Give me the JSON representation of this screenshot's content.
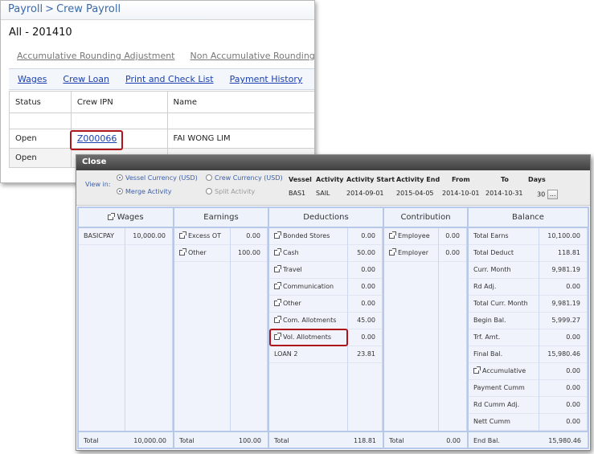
{
  "crew_payroll": {
    "breadcrumb": [
      "Payroll",
      "Crew Payroll"
    ],
    "breadcrumb_separator": ">",
    "title": "All - 201410",
    "adjustment_links": [
      "Accumulative Rounding Adjustment",
      "Non Accumulative Rounding Ad"
    ],
    "tabs": [
      "Wages",
      "Crew Loan",
      "Print and Check List",
      "Payment History"
    ],
    "columns": [
      "Status",
      "Crew IPN",
      "Name"
    ],
    "rows": [
      {
        "status": "Open",
        "ipn": "Z000066",
        "name": "FAI WONG LIM"
      },
      {
        "status": "Open",
        "ipn": "",
        "name": ""
      }
    ]
  },
  "dialog": {
    "close_label": "Close",
    "view_in_label": "View in:",
    "currency_options": {
      "vessel": "Vessel Currency (USD)",
      "crew": "Crew Currency (USD)",
      "selected": "vessel"
    },
    "activity_options": {
      "merge": "Merge Activity",
      "split": "Split Activity",
      "selected": "merge"
    },
    "info_headers": [
      "Vessel",
      "Activity",
      "Activity Start",
      "Activity End",
      "From",
      "To",
      "Days"
    ],
    "info_values": [
      "BAS1",
      "SAIL",
      "2014-09-01",
      "2015-04-05",
      "2014-10-01",
      "2014-10-31",
      "30"
    ],
    "more_button": "...",
    "wages": {
      "header": "Wages",
      "items": [
        {
          "label": "BASICPAY",
          "amount": "10,000.00"
        }
      ],
      "total_label": "Total",
      "total": "10,000.00"
    },
    "earnings": {
      "header": "Earnings",
      "items": [
        {
          "label": "Excess OT",
          "amount": "0.00"
        },
        {
          "label": "Other",
          "amount": "100.00"
        }
      ],
      "total_label": "Total",
      "total": "100.00"
    },
    "deductions": {
      "header": "Deductions",
      "items": [
        {
          "label": "Bonded Stores",
          "amount": "0.00"
        },
        {
          "label": "Cash",
          "amount": "50.00"
        },
        {
          "label": "Travel",
          "amount": "0.00"
        },
        {
          "label": "Communication",
          "amount": "0.00"
        },
        {
          "label": "Other",
          "amount": "0.00"
        },
        {
          "label": "Com. Allotments",
          "amount": "45.00"
        },
        {
          "label": "Vol. Allotments",
          "amount": "0.00"
        },
        {
          "label": "LOAN 2",
          "amount": "23.81"
        }
      ],
      "total_label": "Total",
      "total": "118.81"
    },
    "contribution": {
      "header": "Contribution",
      "items": [
        {
          "label": "Employee",
          "amount": "0.00"
        },
        {
          "label": "Employer",
          "amount": "0.00"
        }
      ],
      "total_label": "Total",
      "total": "0.00"
    },
    "balance": {
      "header": "Balance",
      "items": [
        {
          "label": "Total Earns",
          "amount": "10,100.00"
        },
        {
          "label": "Total Deduct",
          "amount": "118.81"
        },
        {
          "label": "Curr. Month",
          "amount": "9,981.19"
        },
        {
          "label": "Rd Adj.",
          "amount": "0.00"
        },
        {
          "label": "Total Curr. Month",
          "amount": "9,981.19"
        },
        {
          "label": "Begin Bal.",
          "amount": "5,999.27"
        },
        {
          "label": "Trf. Amt.",
          "amount": "0.00"
        },
        {
          "label": "Final Bal.",
          "amount": "15,980.46"
        },
        {
          "label": "Accumulative",
          "amount": "0.00"
        },
        {
          "label": "Payment Cumm",
          "amount": "0.00"
        },
        {
          "label": "Rd Cumm Adj.",
          "amount": "0.00"
        },
        {
          "label": "Nett Cumm",
          "amount": "0.00"
        }
      ],
      "total_label": "End Bal.",
      "total": "15,980.46"
    }
  }
}
